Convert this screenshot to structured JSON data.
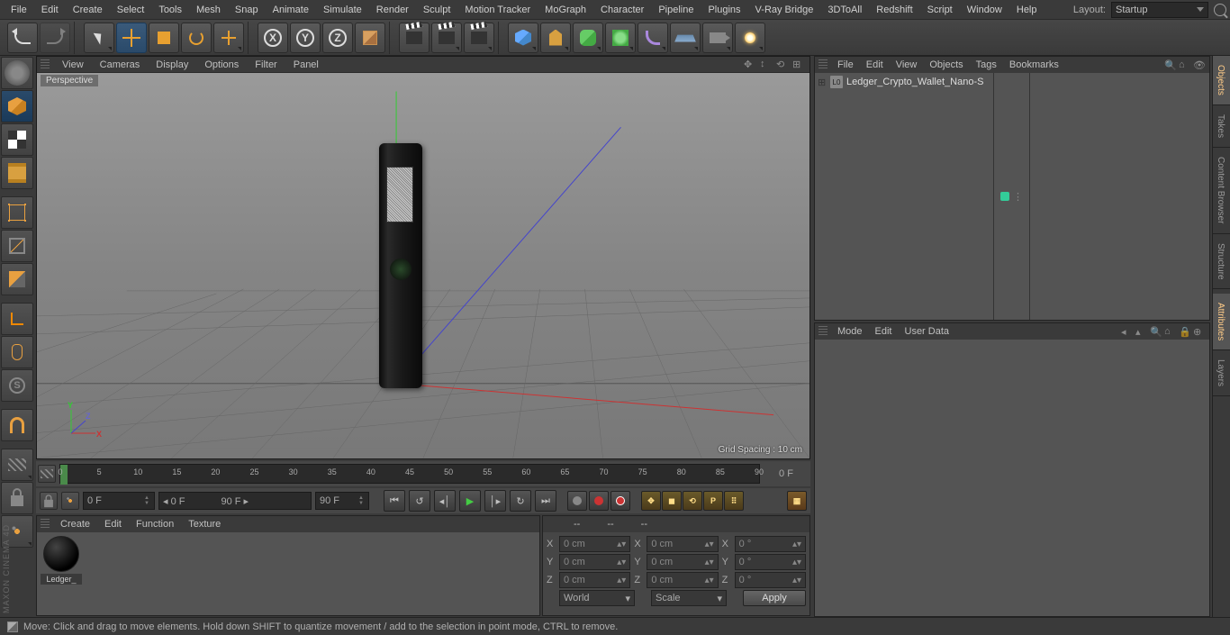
{
  "menubar": {
    "items": [
      "File",
      "Edit",
      "Create",
      "Select",
      "Tools",
      "Mesh",
      "Snap",
      "Animate",
      "Simulate",
      "Render",
      "Sculpt",
      "Motion Tracker",
      "MoGraph",
      "Character",
      "Pipeline",
      "Plugins",
      "V-Ray Bridge",
      "3DToAll",
      "Redshift",
      "Script",
      "Window",
      "Help"
    ],
    "layout_label": "Layout:",
    "layout_value": "Startup"
  },
  "viewport": {
    "menus": [
      "View",
      "Cameras",
      "Display",
      "Options",
      "Filter",
      "Panel"
    ],
    "label": "Perspective",
    "grid_spacing": "Grid Spacing : 10 cm"
  },
  "timeline": {
    "start": "0",
    "end_label": "0 F",
    "ticks": [
      "0",
      "5",
      "10",
      "15",
      "20",
      "25",
      "30",
      "35",
      "40",
      "45",
      "50",
      "55",
      "60",
      "65",
      "70",
      "75",
      "80",
      "85",
      "90"
    ]
  },
  "transport": {
    "frame_current": "0 F",
    "frame_sel_start": "0 F",
    "frame_sel_end": "90 F",
    "frame_total": "90 F"
  },
  "materials": {
    "menus": [
      "Create",
      "Edit",
      "Function",
      "Texture"
    ],
    "items": [
      {
        "name": "Ledger_"
      }
    ]
  },
  "coords": {
    "header": [
      "--",
      "--",
      "--"
    ],
    "rows": [
      {
        "axis": "X",
        "pos": "0 cm",
        "size": "0 cm",
        "rot": "0 °"
      },
      {
        "axis": "Y",
        "pos": "0 cm",
        "size": "0 cm",
        "rot": "0 °"
      },
      {
        "axis": "Z",
        "pos": "0 cm",
        "size": "0 cm",
        "rot": "0 °"
      }
    ],
    "mode1": "World",
    "mode2": "Scale",
    "apply": "Apply"
  },
  "object_manager": {
    "menus": [
      "File",
      "Edit",
      "View",
      "Objects",
      "Tags",
      "Bookmarks"
    ],
    "items": [
      {
        "name": "Ledger_Crypto_Wallet_Nano-S",
        "icon": "L0"
      }
    ]
  },
  "attributes": {
    "menus": [
      "Mode",
      "Edit",
      "User Data"
    ]
  },
  "right_tabs": [
    "Objects",
    "Takes",
    "Content Browser",
    "Structure"
  ],
  "right_tabs2": [
    "Attributes",
    "Layers"
  ],
  "axes": {
    "x": "X",
    "y": "Y",
    "z": "Z"
  },
  "statusbar": {
    "text": "Move: Click and drag to move elements. Hold down SHIFT to quantize movement / add to the selection in point mode, CTRL to remove."
  },
  "brand": "MAXON CINEMA 4D"
}
